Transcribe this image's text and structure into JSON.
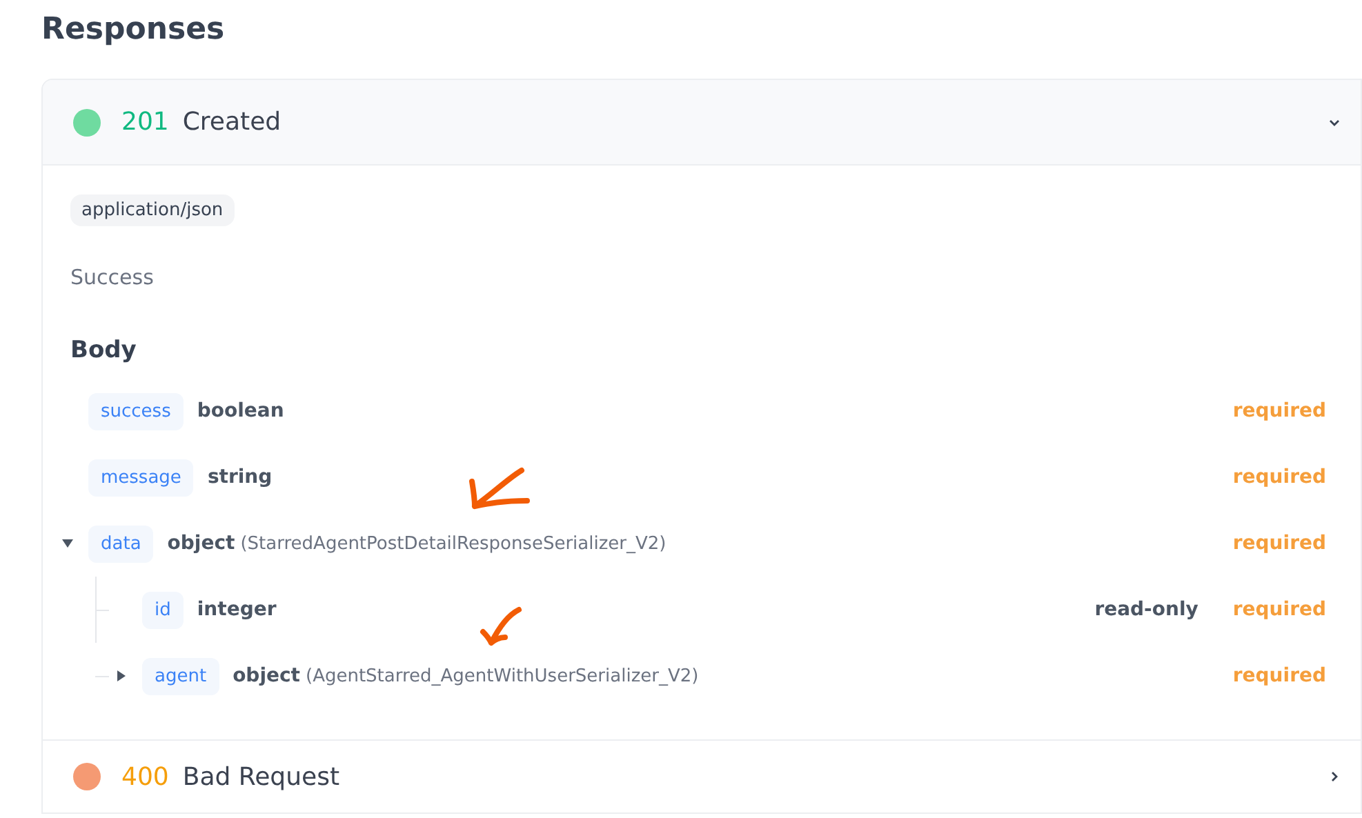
{
  "heading": "Responses",
  "responses": [
    {
      "code": "201",
      "status": "Created",
      "kind": "success",
      "color": "#6fdba0",
      "expanded": true,
      "content_type": "application/json",
      "description": "Success",
      "body_heading": "Body",
      "fields": [
        {
          "name": "success",
          "type": "boolean",
          "required": "required"
        },
        {
          "name": "message",
          "type": "string",
          "required": "required"
        },
        {
          "name": "data",
          "type": "object",
          "schema": "(StarredAgentPostDetailResponseSerializer_V2)",
          "required": "required",
          "expanded": true,
          "children": [
            {
              "name": "id",
              "type": "integer",
              "read_only": "read-only",
              "required": "required"
            },
            {
              "name": "agent",
              "type": "object",
              "schema": "(AgentStarred_AgentWithUserSerializer_V2)",
              "required": "required",
              "expanded": false
            }
          ]
        }
      ]
    },
    {
      "code": "400",
      "status": "Bad Request",
      "kind": "error",
      "color": "#f59a73",
      "expanded": false
    }
  ]
}
